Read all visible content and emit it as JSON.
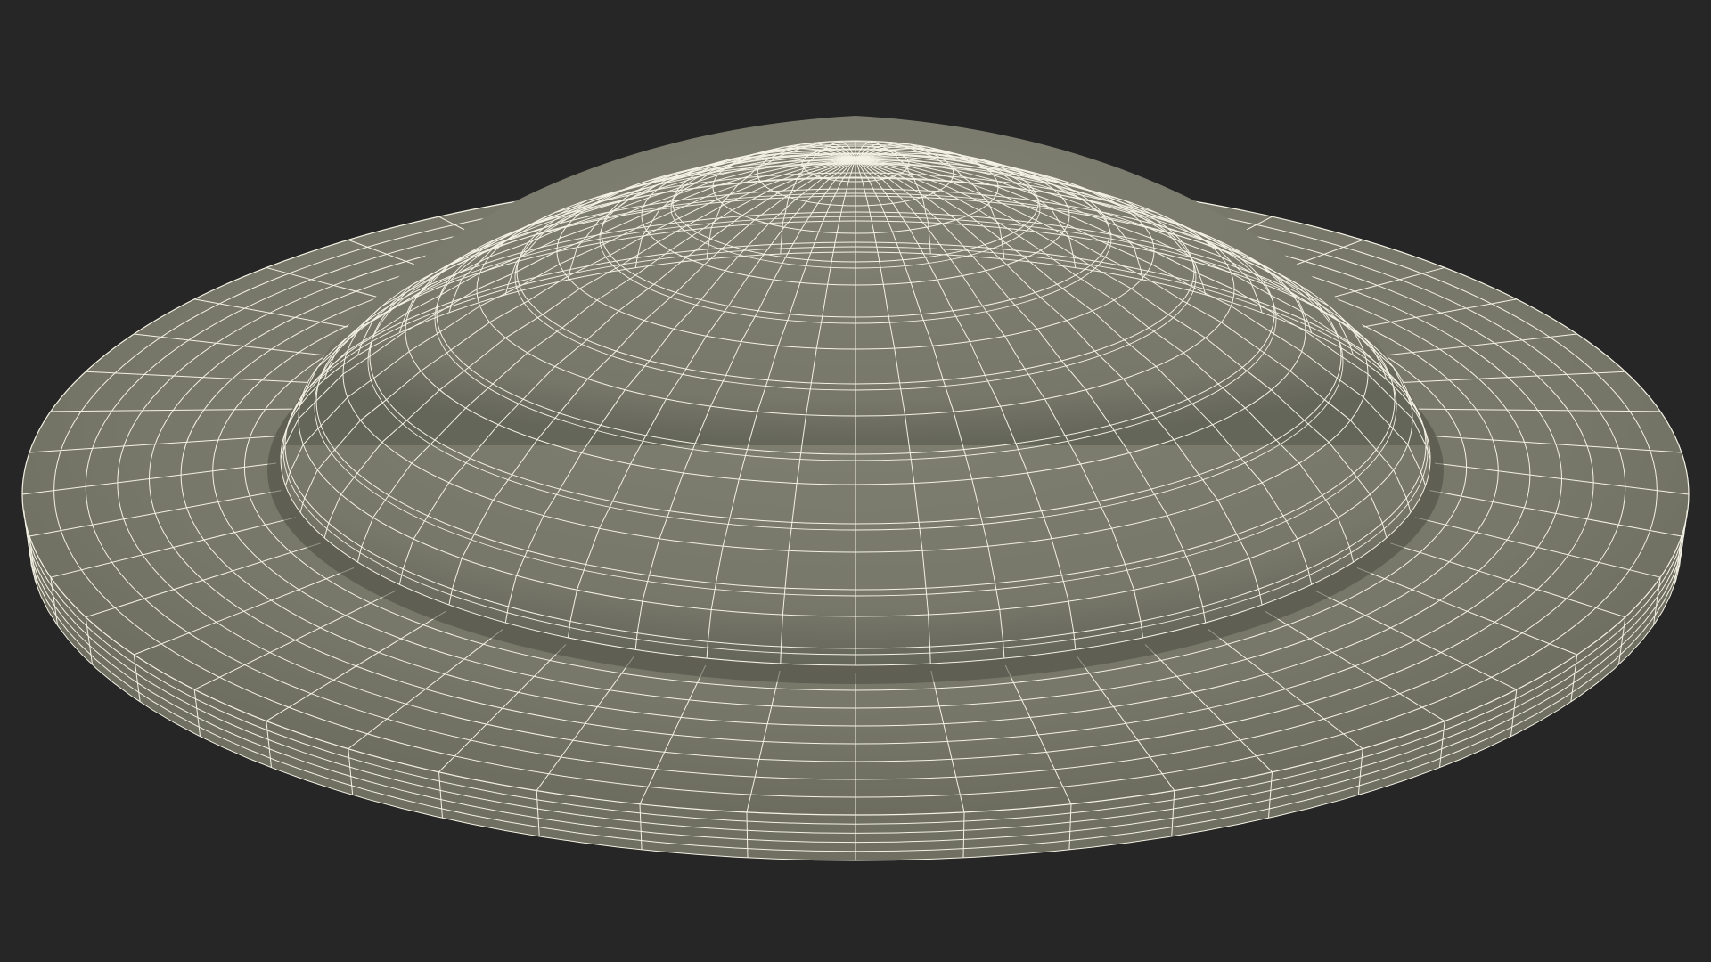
{
  "scene": {
    "description_visible_text": "",
    "background_color": "#262626",
    "surface_color": "#7b7b6d",
    "surface_shadow_color": "#55564c",
    "wire_color": "#f4f2e4"
  }
}
